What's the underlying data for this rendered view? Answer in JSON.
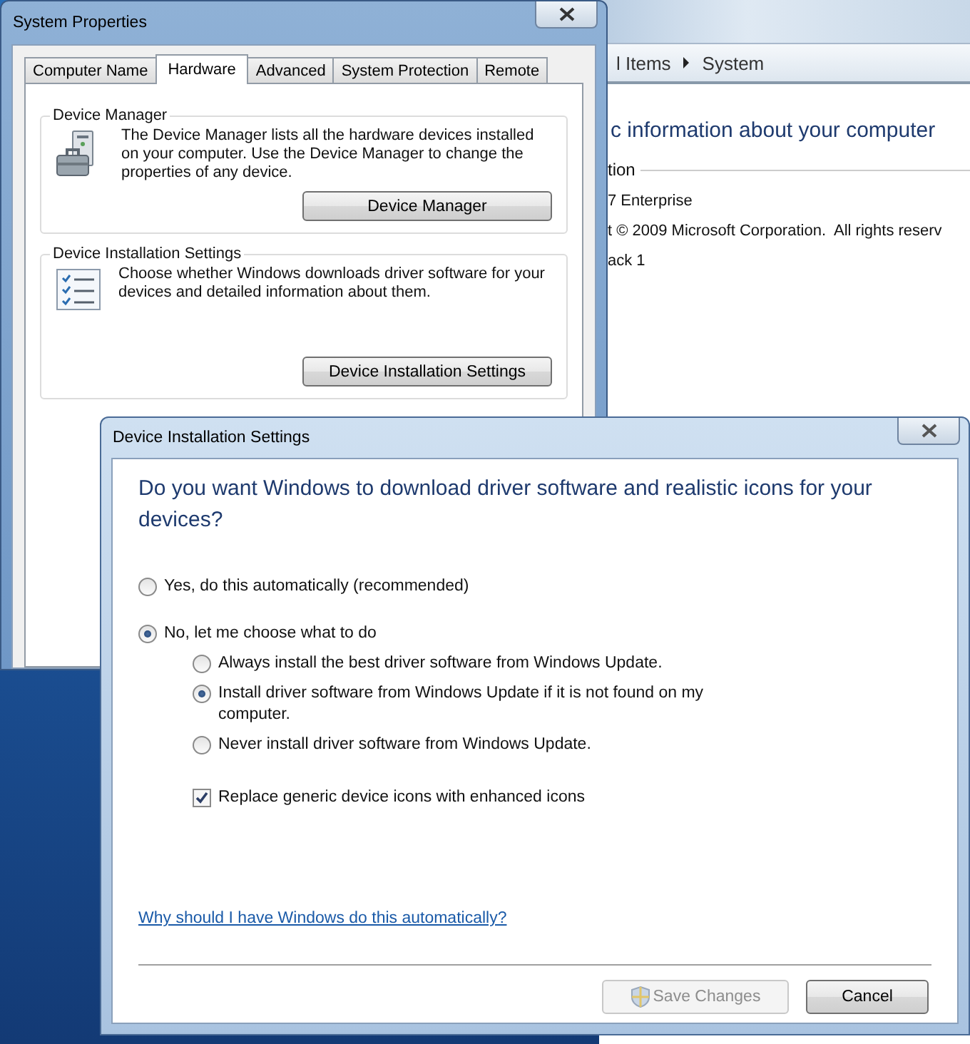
{
  "background_window": {
    "breadcrumb": [
      "l Items",
      "System"
    ],
    "heading": "c information about your computer",
    "section": "tion",
    "lines": [
      "7 Enterprise",
      "t © 2009 Microsoft Corporation.  All rights reserv",
      "ack 1"
    ]
  },
  "system_properties": {
    "title": "System Properties",
    "tabs": [
      {
        "label": "Computer Name",
        "selected": false
      },
      {
        "label": "Hardware",
        "selected": true
      },
      {
        "label": "Advanced",
        "selected": false
      },
      {
        "label": "System Protection",
        "selected": false
      },
      {
        "label": "Remote",
        "selected": false
      }
    ],
    "groups": [
      {
        "kind": "devices",
        "title": "Device Manager",
        "text": "The Device Manager lists all the hardware devices installed on your computer. Use the Device Manager to change the properties of any device.",
        "button": "Device Manager"
      },
      {
        "kind": "checklist",
        "title": "Device Installation Settings",
        "text": "Choose whether Windows downloads driver software for your devices and detailed information about them.",
        "button": "Device Installation Settings"
      }
    ]
  },
  "dialog": {
    "title": "Device Installation Settings",
    "question": "Do you want Windows to download driver software and realistic icons for your devices?",
    "options": [
      {
        "label": "Yes, do this automatically (recommended)",
        "selected": false
      },
      {
        "label": "No, let me choose what to do",
        "selected": true,
        "children": [
          {
            "label": "Always install the best driver software from Windows Update.",
            "selected": false
          },
          {
            "label": "Install driver software from Windows Update if it is not found on my computer.",
            "selected": true
          },
          {
            "label": "Never install driver software from Windows Update.",
            "selected": false
          }
        ]
      }
    ],
    "checkbox": {
      "label": "Replace generic device icons with enhanced icons",
      "checked": true
    },
    "link": "Why should I have Windows do this automatically?",
    "buttons": [
      {
        "label": "Save Changes",
        "disabled": true,
        "shield": true
      },
      {
        "label": "Cancel",
        "disabled": false,
        "shield": false
      }
    ]
  }
}
